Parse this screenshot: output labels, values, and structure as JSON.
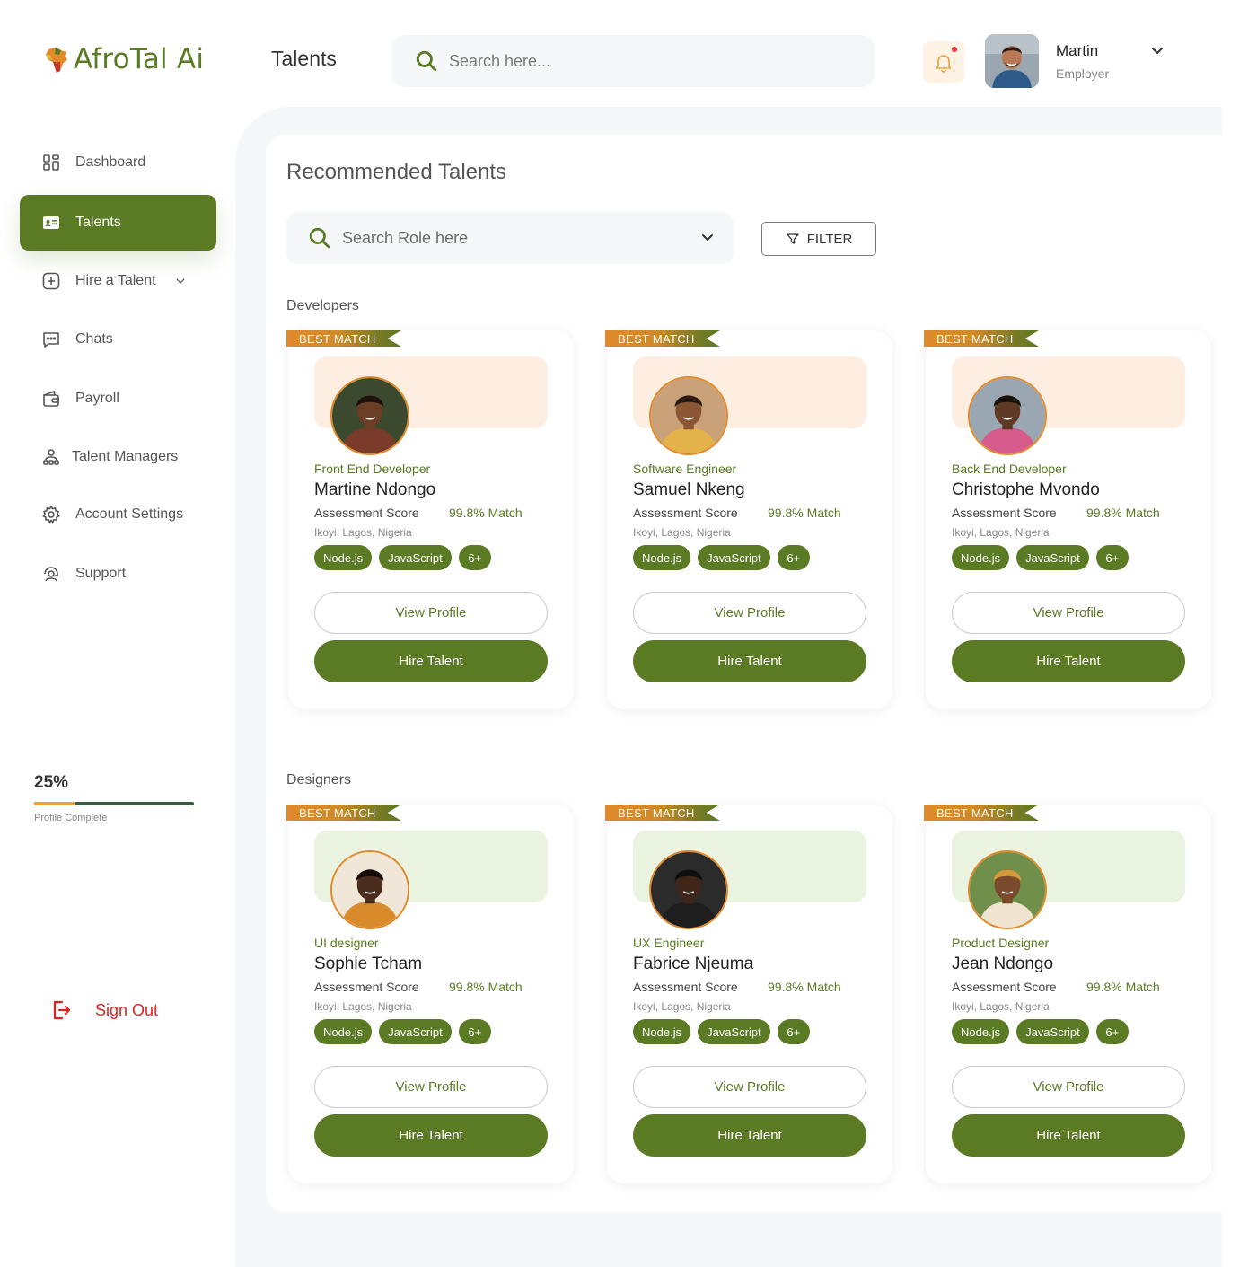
{
  "brand": {
    "name": "AfroTal Ai",
    "accent": "#5a7a24",
    "orange": "#e08a2c"
  },
  "header": {
    "title": "Talents",
    "search_placeholder": "Search here...",
    "user": {
      "name": "Martin",
      "role": "Employer"
    }
  },
  "sidebar": {
    "items": [
      {
        "label": "Dashboard",
        "icon": "dashboard-icon"
      },
      {
        "label": "Talents",
        "icon": "id-card-icon",
        "active": true
      },
      {
        "label": "Hire a Talent",
        "icon": "plus-square-icon"
      },
      {
        "label": "Chats",
        "icon": "chat-icon"
      },
      {
        "label": "Payroll",
        "icon": "wallet-icon"
      },
      {
        "label": "Talent Managers",
        "icon": "user-group-icon"
      },
      {
        "label": "Account Settings",
        "icon": "gear-icon"
      },
      {
        "label": "Support",
        "icon": "support-icon"
      }
    ],
    "profile_progress": {
      "value_label": "25%",
      "fraction": 0.25,
      "caption": "Profile Complete"
    },
    "signout_label": "Sign Out"
  },
  "main": {
    "title": "Recommended Talents",
    "role_search_placeholder": "Search Role here",
    "filter_label": "FILTER",
    "ribbon_label": "BEST MATCH",
    "score_label": "Assessment Score",
    "view_label": "View Profile",
    "hire_label": "Hire Talent",
    "groups": [
      {
        "label": "Developers",
        "talents": [
          {
            "role": "Front End Developer",
            "name": "Martine Ndongo",
            "score": "99.8% Match",
            "location": "Ikoyi, Lagos, Nigeria",
            "tags": [
              "Node.js",
              "JavaScript",
              "6+"
            ]
          },
          {
            "role": "Software Engineer",
            "name": "Samuel Nkeng",
            "score": "99.8% Match",
            "location": "Ikoyi, Lagos, Nigeria",
            "tags": [
              "Node.js",
              "JavaScript",
              "6+"
            ]
          },
          {
            "role": "Back End Developer",
            "name": "Christophe Mvondo",
            "score": "99.8% Match",
            "location": "Ikoyi, Lagos, Nigeria",
            "tags": [
              "Node.js",
              "JavaScript",
              "6+"
            ]
          }
        ]
      },
      {
        "label": "Designers",
        "talents": [
          {
            "role": "UI designer",
            "name": "Sophie Tcham",
            "score": "99.8% Match",
            "location": "Ikoyi, Lagos, Nigeria",
            "tags": [
              "Node.js",
              "JavaScript",
              "6+"
            ]
          },
          {
            "role": "UX Engineer",
            "name": "Fabrice Njeuma",
            "score": "99.8% Match",
            "location": "Ikoyi, Lagos, Nigeria",
            "tags": [
              "Node.js",
              "JavaScript",
              "6+"
            ]
          },
          {
            "role": "Product Designer",
            "name": "Jean Ndongo",
            "score": "99.8% Match",
            "location": "Ikoyi, Lagos, Nigeria",
            "tags": [
              "Node.js",
              "JavaScript",
              "6+"
            ]
          }
        ]
      }
    ]
  }
}
